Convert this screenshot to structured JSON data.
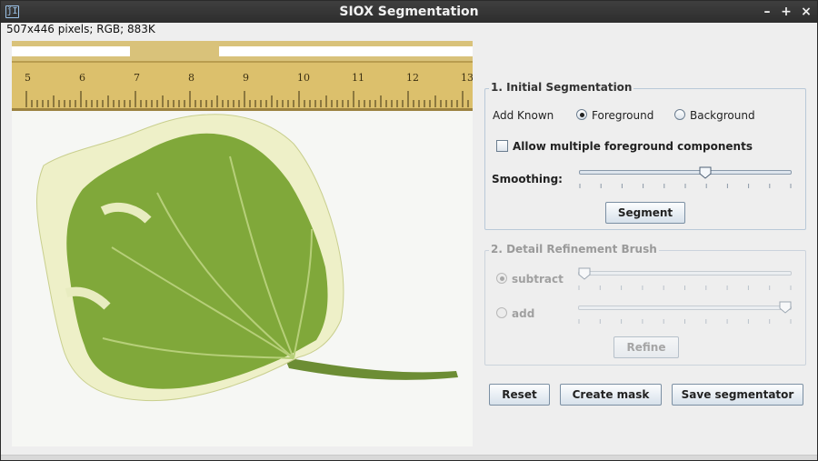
{
  "window": {
    "title": "SIOX Segmentation",
    "app_icon_text": "ǰI",
    "minimize": "–",
    "maximize": "+",
    "close": "×"
  },
  "status_text": "507x446 pixels; RGB; 883K",
  "ruler": {
    "numbers": [
      "5",
      "6",
      "7",
      "8",
      "9",
      "10",
      "11",
      "12",
      "13"
    ]
  },
  "initial_segmentation": {
    "title": "1. Initial Segmentation",
    "add_known_label": "Add Known",
    "foreground_label": "Foreground",
    "background_label": "Background",
    "selected": "foreground",
    "multiple_fg_label": "Allow multiple foreground components",
    "multiple_fg_checked": false,
    "smoothing_label": "Smoothing:",
    "smoothing_value_fraction": 0.6,
    "segment_button": "Segment"
  },
  "refinement": {
    "title": "2. Detail Refinement Brush",
    "subtract_label": "subtract",
    "add_label": "add",
    "selected": "subtract",
    "subtract_value_fraction": 0.0,
    "add_value_fraction": 1.0,
    "refine_button": "Refine"
  },
  "actions": {
    "reset": "Reset",
    "create_mask": "Create mask",
    "save_segmentator": "Save segmentator"
  },
  "colors": {
    "leaf_green": "#7fa83a",
    "leaf_edge": "#eef0c8",
    "ruler_yellow": "#d8bd6a"
  }
}
